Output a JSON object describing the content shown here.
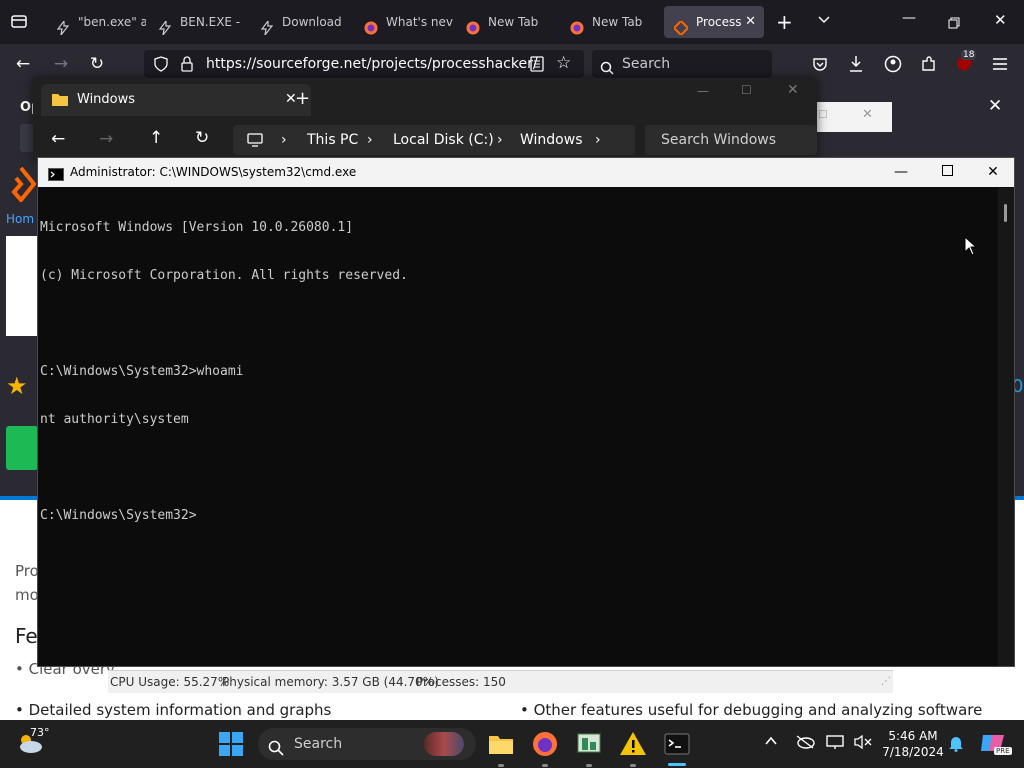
{
  "browser": {
    "tabs": [
      {
        "label": "\"ben.exe\" a",
        "favicon": "bolt-icon",
        "active": false
      },
      {
        "label": "BEN.EXE -",
        "favicon": "bolt-icon",
        "active": false
      },
      {
        "label": "Download",
        "favicon": "bolt-icon",
        "active": false
      },
      {
        "label": "What's nev",
        "favicon": "firefox-icon",
        "active": false
      },
      {
        "label": "New Tab",
        "favicon": "firefox-icon",
        "active": false
      },
      {
        "label": "New Tab",
        "favicon": "firefox-icon",
        "active": false
      },
      {
        "label": "Process",
        "favicon": "sourceforge-icon",
        "active": true
      }
    ],
    "url": "https://sourceforge.net/projects/processhacker/",
    "search_placeholder": "Search",
    "extension_badge": "18"
  },
  "webpage": {
    "partial_texts": [
      "Op",
      "Hom",
      "Pro",
      "mo",
      "Fe",
      "• Clear overv"
    ],
    "bullet_left": "• Detailed system information and graphs",
    "bullet_right": "• Other features useful for debugging and analyzing software",
    "edge_digit": "0"
  },
  "explorer": {
    "tab_title": "Windows",
    "breadcrumb": [
      "This PC",
      "Local Disk (C:)",
      "Windows"
    ],
    "search_placeholder": "Search Windows"
  },
  "cmd": {
    "title": "Administrator: C:\\WINDOWS\\system32\\cmd.exe",
    "lines": [
      "Microsoft Windows [Version 10.0.26080.1]",
      "(c) Microsoft Corporation. All rights reserved.",
      "",
      "C:\\Windows\\System32>whoami",
      "nt authority\\system",
      "",
      "C:\\Windows\\System32>"
    ]
  },
  "statusbar": {
    "cpu": "CPU Usage: 55.27%",
    "memory": "Physical memory: 3.57 GB (44.70%)",
    "processes": "Processes: 150"
  },
  "taskbar": {
    "weather_temp": "73°",
    "search_label": "Search",
    "time": "5:46 AM",
    "date": "7/18/2024",
    "copilot_badge": "PRE"
  },
  "colors": {
    "firefox_dark": "#1c1b22",
    "accent_blue": "#0078d4",
    "sourceforge_orange": "#ff6600"
  }
}
